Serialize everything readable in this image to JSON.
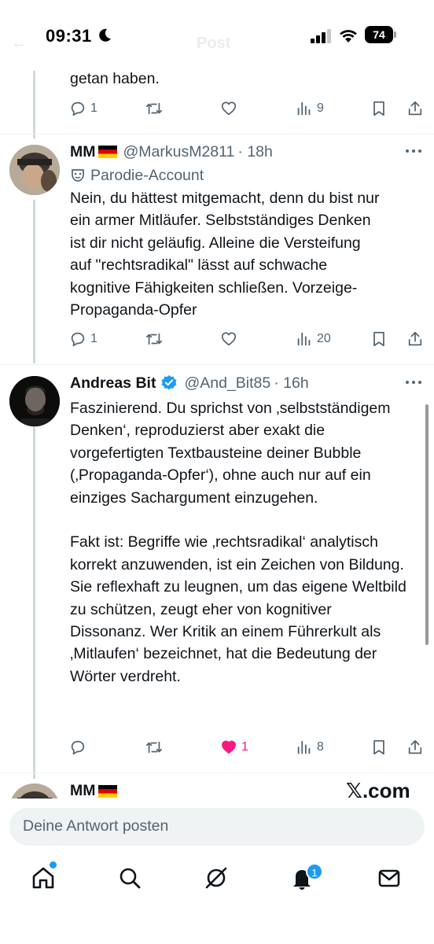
{
  "status_bar": {
    "time": "09:31",
    "battery": "74"
  },
  "header": {
    "title": "Post"
  },
  "tweets": [
    {
      "text_fragment": "getan haben.",
      "stats": {
        "replies": "1",
        "reposts": "",
        "likes": "",
        "views": "9"
      }
    },
    {
      "name": "MM",
      "handle": "@MarkusM2811",
      "time": "· 18h",
      "label": "Parodie-Account",
      "text": "Nein, du hättest mitgemacht, denn du bist nur ein armer Mitläufer. Selbstständiges Denken ist dir nicht geläufig. Alleine die Versteifung auf \"rechtsradikal\" lässt auf schwache kognitive Fähigkeiten schließen. Vorzeige-Propaganda-Opfer",
      "stats": {
        "replies": "1",
        "reposts": "",
        "likes": "",
        "views": "20"
      }
    },
    {
      "name": "Andreas Bit",
      "handle": "@And_Bit85",
      "time": "· 16h",
      "text": "Faszinierend. Du sprichst von ‚selbstständigem Denken‘, reproduzierst aber exakt die vorgefertigten Textbausteine deiner Bubble (‚Propaganda-Opfer‘), ohne auch nur auf ein einziges Sachargument einzugehen.\n\nFakt ist: Begriffe wie ‚rechtsradikal‘ analytisch korrekt anzuwenden, ist ein Zeichen von Bildung. Sie reflexhaft zu leugnen, um das eigene Weltbild zu schützen, zeugt eher von kognitiver Dissonanz. Wer Kritik an einem Führerkult als ‚Mitlaufen‘ bezeichnet, hat die Bedeutung der Wörter verdreht.",
      "stats": {
        "replies": "",
        "reposts": "",
        "likes": "1",
        "views": "8"
      }
    },
    {
      "name": "MM"
    }
  ],
  "watermark": "𝕏.com",
  "compose": {
    "placeholder": "Deine Antwort posten"
  },
  "nav": {
    "notifications_badge": "1"
  },
  "colors": {
    "accent": "#1d9bf0",
    "like": "#f91880",
    "muted": "#536471"
  }
}
